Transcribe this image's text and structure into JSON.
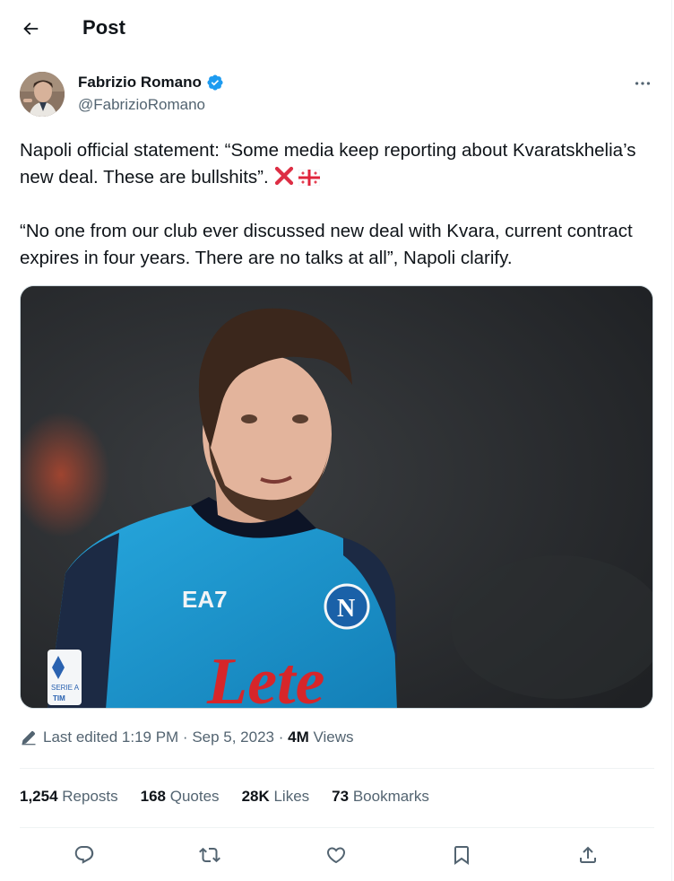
{
  "header": {
    "title": "Post",
    "back_icon": "arrow-left-icon"
  },
  "author": {
    "name": "Fabrizio Romano",
    "handle": "@FabrizioRomano",
    "verified_icon": "verified-badge-icon",
    "verified_color": "#1d9bf0",
    "more_icon": "more-horizontal-icon"
  },
  "tweet": {
    "paragraph1": "Napoli official statement: “Some media keep reporting about Kvaratskhelia’s new deal. These are bullshits”. ",
    "paragraph1_emojis": [
      "cross-mark-emoji",
      "georgia-flag-emoji"
    ],
    "paragraph2": "“No one from our club ever discussed new deal with Kvara, current contract expires in four years. There are no talks at all”, Napoli clarify."
  },
  "media": {
    "image_icon": "photo-player-icon",
    "jersey_brand": "EA7",
    "jersey_sponsor": "Lete",
    "sleeve_patch_line1": "SERIE A",
    "sleeve_patch_line2": "TIM"
  },
  "meta": {
    "edit_icon": "pencil-icon",
    "edited_label": "Last edited 1:19 PM · Sep 5, 2023 · ",
    "views_count": "4M",
    "views_label": " Views"
  },
  "stats": {
    "reposts_count": "1,254",
    "reposts_label": " Reposts",
    "quotes_count": "168",
    "quotes_label": " Quotes",
    "likes_count": "28K",
    "likes_label": " Likes",
    "bookmarks_count": "73",
    "bookmarks_label": " Bookmarks"
  },
  "actions": {
    "icons": [
      "reply-icon",
      "repost-icon",
      "like-icon",
      "bookmark-icon",
      "share-icon"
    ]
  },
  "colors": {
    "text": "#0f1419",
    "secondary": "#536471",
    "divider": "#eff3f4",
    "verified": "#1d9bf0",
    "napoli_blue": "#1aa0d8",
    "lete_red": "#d6262a"
  }
}
